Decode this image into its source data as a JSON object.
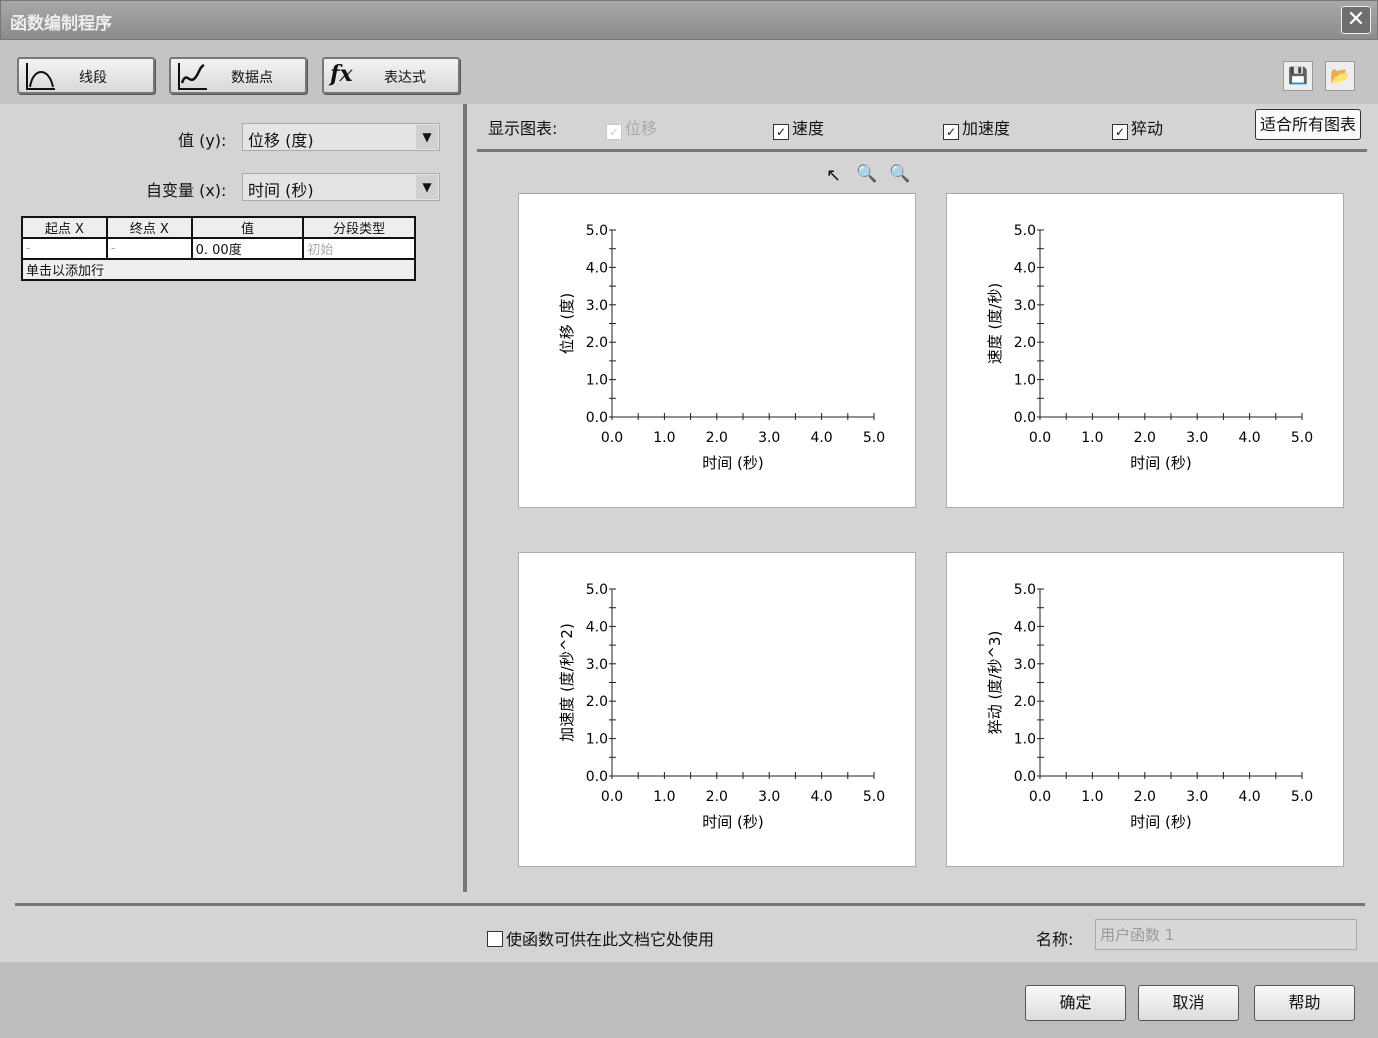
{
  "window": {
    "title": "函数编制程序",
    "close": "✕"
  },
  "toolbar": {
    "buttons": [
      {
        "label": "线段",
        "icon": "segment-curve-icon"
      },
      {
        "label": "数据点",
        "icon": "data-points-icon"
      },
      {
        "label": "表达式",
        "icon": "fx-icon",
        "glyph": "fx"
      }
    ],
    "save_icon": "save-icon",
    "open_icon": "open-icon"
  },
  "left": {
    "value_label": "值 (y):",
    "value_selected": "位移 (度)",
    "var_label": "自变量 (x):",
    "var_selected": "时间 (秒)",
    "table": {
      "headers": [
        "起点 X",
        "终点 X",
        "值",
        "分段类型"
      ],
      "rows": [
        [
          "-",
          "-",
          "0. 00度",
          "初始"
        ]
      ],
      "add_row": "单击以添加行"
    }
  },
  "right": {
    "show_label": "显示图表:",
    "checks": [
      {
        "label": "位移",
        "checked": true,
        "disabled": true
      },
      {
        "label": "速度",
        "checked": true
      },
      {
        "label": "加速度",
        "checked": true
      },
      {
        "label": "猝动",
        "checked": true
      }
    ],
    "fit_all": "适合所有图表"
  },
  "chart_data": [
    {
      "type": "line",
      "ylabel": "位移 (度)",
      "xlabel": "时间 (秒)",
      "xlim": [
        0,
        5
      ],
      "ylim": [
        0,
        5
      ],
      "xticks": [
        "0.0",
        "1.0",
        "2.0",
        "3.0",
        "4.0",
        "5.0"
      ],
      "yticks": [
        "0.0",
        "1.0",
        "2.0",
        "3.0",
        "4.0",
        "5.0"
      ],
      "series": []
    },
    {
      "type": "line",
      "ylabel": "速度 (度/秒)",
      "xlabel": "时间 (秒)",
      "xlim": [
        0,
        5
      ],
      "ylim": [
        0,
        5
      ],
      "xticks": [
        "0.0",
        "1.0",
        "2.0",
        "3.0",
        "4.0",
        "5.0"
      ],
      "yticks": [
        "0.0",
        "1.0",
        "2.0",
        "3.0",
        "4.0",
        "5.0"
      ],
      "series": []
    },
    {
      "type": "line",
      "ylabel": "加速度 (度/秒^2)",
      "xlabel": "时间 (秒)",
      "xlim": [
        0,
        5
      ],
      "ylim": [
        0,
        5
      ],
      "xticks": [
        "0.0",
        "1.0",
        "2.0",
        "3.0",
        "4.0",
        "5.0"
      ],
      "yticks": [
        "0.0",
        "1.0",
        "2.0",
        "3.0",
        "4.0",
        "5.0"
      ],
      "series": []
    },
    {
      "type": "line",
      "ylabel": "猝动 (度/秒^3)",
      "xlabel": "时间 (秒)",
      "xlim": [
        0,
        5
      ],
      "ylim": [
        0,
        5
      ],
      "xticks": [
        "0.0",
        "1.0",
        "2.0",
        "3.0",
        "4.0",
        "5.0"
      ],
      "yticks": [
        "0.0",
        "1.0",
        "2.0",
        "3.0",
        "4.0",
        "5.0"
      ],
      "series": []
    }
  ],
  "footer": {
    "share_label": "使函数可供在此文档它处使用",
    "share_checked": false,
    "name_label": "名称:",
    "name_value": "用户函数 1",
    "ok": "确定",
    "cancel": "取消",
    "help": "帮助"
  }
}
